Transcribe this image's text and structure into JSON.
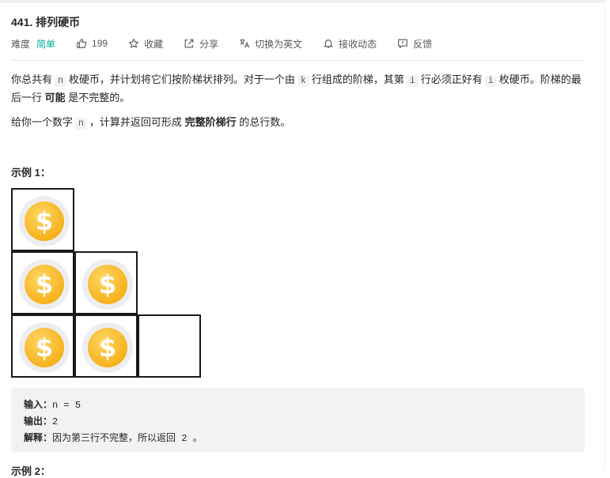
{
  "problem": {
    "title": "441. 排列硬币",
    "difficulty_label": "难度",
    "difficulty_value": "简单",
    "likes": "199",
    "favorite": "收藏",
    "share": "分享",
    "switch_lang": "切换为英文",
    "subscribe": "接收动态",
    "feedback": "反馈"
  },
  "description": {
    "p1_a": "你总共有",
    "p1_n": "n",
    "p1_b": "枚硬币，并计划将它们按阶梯状排列。对于一个由",
    "p1_k": "k",
    "p1_c": "行组成的阶梯，其第",
    "p1_i": "i",
    "p1_d": "行必须正好有",
    "p1_i2": "i",
    "p1_e": "枚硬币。阶梯的最后一行",
    "p1_bold": "可能",
    "p1_f": "是不完整的。",
    "p2_a": "给你一个数字",
    "p2_n": "n",
    "p2_b": "，计算并返回可形成",
    "p2_bold": "完整阶梯行",
    "p2_c": "的总行数。"
  },
  "example1": {
    "title": "示例 1：",
    "coin_symbol": "$",
    "input_label": "输入：",
    "input_value": "n = 5",
    "output_label": "输出：",
    "output_value": "2",
    "explain_label": "解释：",
    "explain_value": "因为第三行不完整，所以返回 2 。"
  },
  "example2": {
    "title": "示例 2："
  }
}
